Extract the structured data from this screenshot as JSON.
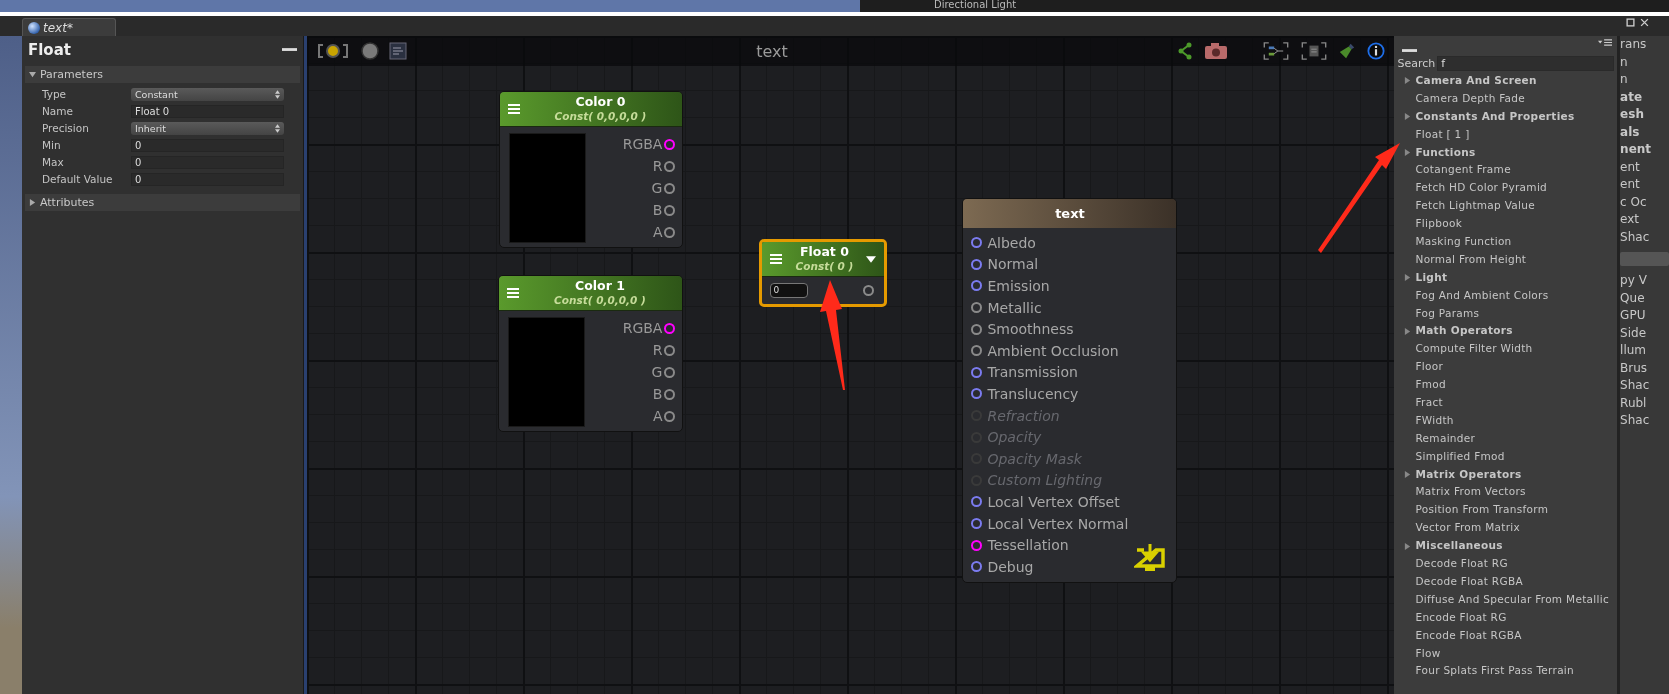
{
  "background": {
    "label": "Directional Light"
  },
  "window": {
    "tab_title": "text*"
  },
  "properties_panel": {
    "title": "Float",
    "sections": [
      {
        "label": "Parameters",
        "expanded": true,
        "fields": [
          {
            "label": "Type",
            "value": "Constant",
            "kind": "dropdown"
          },
          {
            "label": "Name",
            "value": "Float 0",
            "kind": "text"
          },
          {
            "label": "Precision",
            "value": "Inherit",
            "kind": "dropdown"
          },
          {
            "label": "Min",
            "value": "0",
            "kind": "text"
          },
          {
            "label": "Max",
            "value": "0",
            "kind": "text"
          },
          {
            "label": "Default Value",
            "value": "0",
            "kind": "text"
          }
        ]
      },
      {
        "label": "Attributes",
        "expanded": false
      }
    ]
  },
  "canvas": {
    "title": "text",
    "nodes": [
      {
        "kind": "color",
        "title": "Color 0",
        "subtitle": "Const( 0,0,0,0 )",
        "selected": false,
        "ports": [
          {
            "label": "RGBA",
            "color": "#ff00ff"
          },
          {
            "label": "R",
            "color": "#8a8a8a"
          },
          {
            "label": "G",
            "color": "#8a8a8a"
          },
          {
            "label": "B",
            "color": "#8a8a8a"
          },
          {
            "label": "A",
            "color": "#8a8a8a"
          }
        ]
      },
      {
        "kind": "color",
        "title": "Color 1",
        "subtitle": "Const( 0,0,0,0 )",
        "selected": false,
        "ports": [
          {
            "label": "RGBA",
            "color": "#ff00ff"
          },
          {
            "label": "R",
            "color": "#8a8a8a"
          },
          {
            "label": "G",
            "color": "#8a8a8a"
          },
          {
            "label": "B",
            "color": "#8a8a8a"
          },
          {
            "label": "A",
            "color": "#8a8a8a"
          }
        ]
      },
      {
        "kind": "float",
        "title": "Float 0",
        "subtitle": "Const( 0 )",
        "selected": true,
        "value": "0",
        "ports": [
          {
            "color": "#8a8a8a"
          }
        ]
      },
      {
        "kind": "output",
        "title": "text",
        "selected": false,
        "ports": [
          {
            "label": "Albedo",
            "color": "#7b7bef",
            "disabled": false
          },
          {
            "label": "Normal",
            "color": "#7b7bef",
            "disabled": false
          },
          {
            "label": "Emission",
            "color": "#7b7bef",
            "disabled": false
          },
          {
            "label": "Metallic",
            "color": "#8a8a8a",
            "disabled": false
          },
          {
            "label": "Smoothness",
            "color": "#8a8a8a",
            "disabled": false
          },
          {
            "label": "Ambient Occlusion",
            "color": "#8a8a8a",
            "disabled": false
          },
          {
            "label": "Transmission",
            "color": "#7b7bef",
            "disabled": false
          },
          {
            "label": "Translucency",
            "color": "#7b7bef",
            "disabled": false
          },
          {
            "label": "Refraction",
            "color": "#3a3a3a",
            "disabled": true
          },
          {
            "label": "Opacity",
            "color": "#3a3a3a",
            "disabled": true
          },
          {
            "label": "Opacity Mask",
            "color": "#3a3a3a",
            "disabled": true
          },
          {
            "label": "Custom Lighting",
            "color": "#3a3a3a",
            "disabled": true
          },
          {
            "label": "Local Vertex Offset",
            "color": "#7b7bef",
            "disabled": false
          },
          {
            "label": "Local Vertex Normal",
            "color": "#7b7bef",
            "disabled": false
          },
          {
            "label": "Tessellation",
            "color": "#ff00ff",
            "disabled": false
          },
          {
            "label": "Debug",
            "color": "#7b7bef",
            "disabled": false
          }
        ]
      }
    ]
  },
  "palette": {
    "search_label": "Search",
    "search_value": "f",
    "items": [
      {
        "label": "Camera And Screen",
        "kind": "category"
      },
      {
        "label": "Camera Depth Fade",
        "kind": "node"
      },
      {
        "label": "Constants And Properties",
        "kind": "category"
      },
      {
        "label": "Float [ 1 ]",
        "kind": "node"
      },
      {
        "label": "Functions",
        "kind": "category"
      },
      {
        "label": "Cotangent Frame",
        "kind": "node"
      },
      {
        "label": "Fetch HD Color Pyramid",
        "kind": "node"
      },
      {
        "label": "Fetch Lightmap Value",
        "kind": "node"
      },
      {
        "label": "Flipbook",
        "kind": "node"
      },
      {
        "label": "Masking Function",
        "kind": "node"
      },
      {
        "label": "Normal From Height",
        "kind": "node"
      },
      {
        "label": "Light",
        "kind": "category"
      },
      {
        "label": "Fog And Ambient Colors",
        "kind": "node"
      },
      {
        "label": "Fog Params",
        "kind": "node"
      },
      {
        "label": "Math Operators",
        "kind": "category"
      },
      {
        "label": "Compute Filter Width",
        "kind": "node"
      },
      {
        "label": "Floor",
        "kind": "node"
      },
      {
        "label": "Fmod",
        "kind": "node"
      },
      {
        "label": "Fract",
        "kind": "node"
      },
      {
        "label": "FWidth",
        "kind": "node"
      },
      {
        "label": "Remainder",
        "kind": "node"
      },
      {
        "label": "Simplified Fmod",
        "kind": "node"
      },
      {
        "label": "Matrix Operators",
        "kind": "category"
      },
      {
        "label": "Matrix From Vectors",
        "kind": "node"
      },
      {
        "label": "Position From Transform",
        "kind": "node"
      },
      {
        "label": "Vector From Matrix",
        "kind": "node"
      },
      {
        "label": "Miscellaneous",
        "kind": "category"
      },
      {
        "label": "Decode Float RG",
        "kind": "node"
      },
      {
        "label": "Decode Float RGBA",
        "kind": "node"
      },
      {
        "label": "Diffuse And Specular From Metallic",
        "kind": "node"
      },
      {
        "label": "Encode Float RG",
        "kind": "node"
      },
      {
        "label": "Encode Float RGBA",
        "kind": "node"
      },
      {
        "label": "Flow",
        "kind": "node"
      },
      {
        "label": "Four Splats First Pass Terrain",
        "kind": "node"
      }
    ]
  },
  "inspector_fragments": [
    {
      "label": "rans",
      "kind": "text"
    },
    {
      "label": "n",
      "kind": "text"
    },
    {
      "label": "n",
      "kind": "text"
    },
    {
      "label": "ate",
      "kind": "bold"
    },
    {
      "label": "esh",
      "kind": "bold"
    },
    {
      "label": "als",
      "kind": "bold"
    },
    {
      "label": "nent",
      "kind": "bold"
    },
    {
      "label": "ent",
      "kind": "text"
    },
    {
      "label": "ent",
      "kind": "text"
    },
    {
      "label": "c Oc",
      "kind": "text"
    },
    {
      "label": "ext",
      "kind": "text"
    },
    {
      "label": "Shac",
      "kind": "text"
    },
    {
      "kind": "button"
    },
    {
      "label": "py V",
      "kind": "text"
    },
    {
      "label": "Que",
      "kind": "text"
    },
    {
      "label": "GPU",
      "kind": "text"
    },
    {
      "label": "Side",
      "kind": "text"
    },
    {
      "label": "llum",
      "kind": "text"
    },
    {
      "label": "Brus",
      "kind": "text"
    },
    {
      "label": "Shac",
      "kind": "text"
    },
    {
      "label": "Rubl",
      "kind": "text"
    },
    {
      "label": "Shac",
      "kind": "text"
    }
  ]
}
